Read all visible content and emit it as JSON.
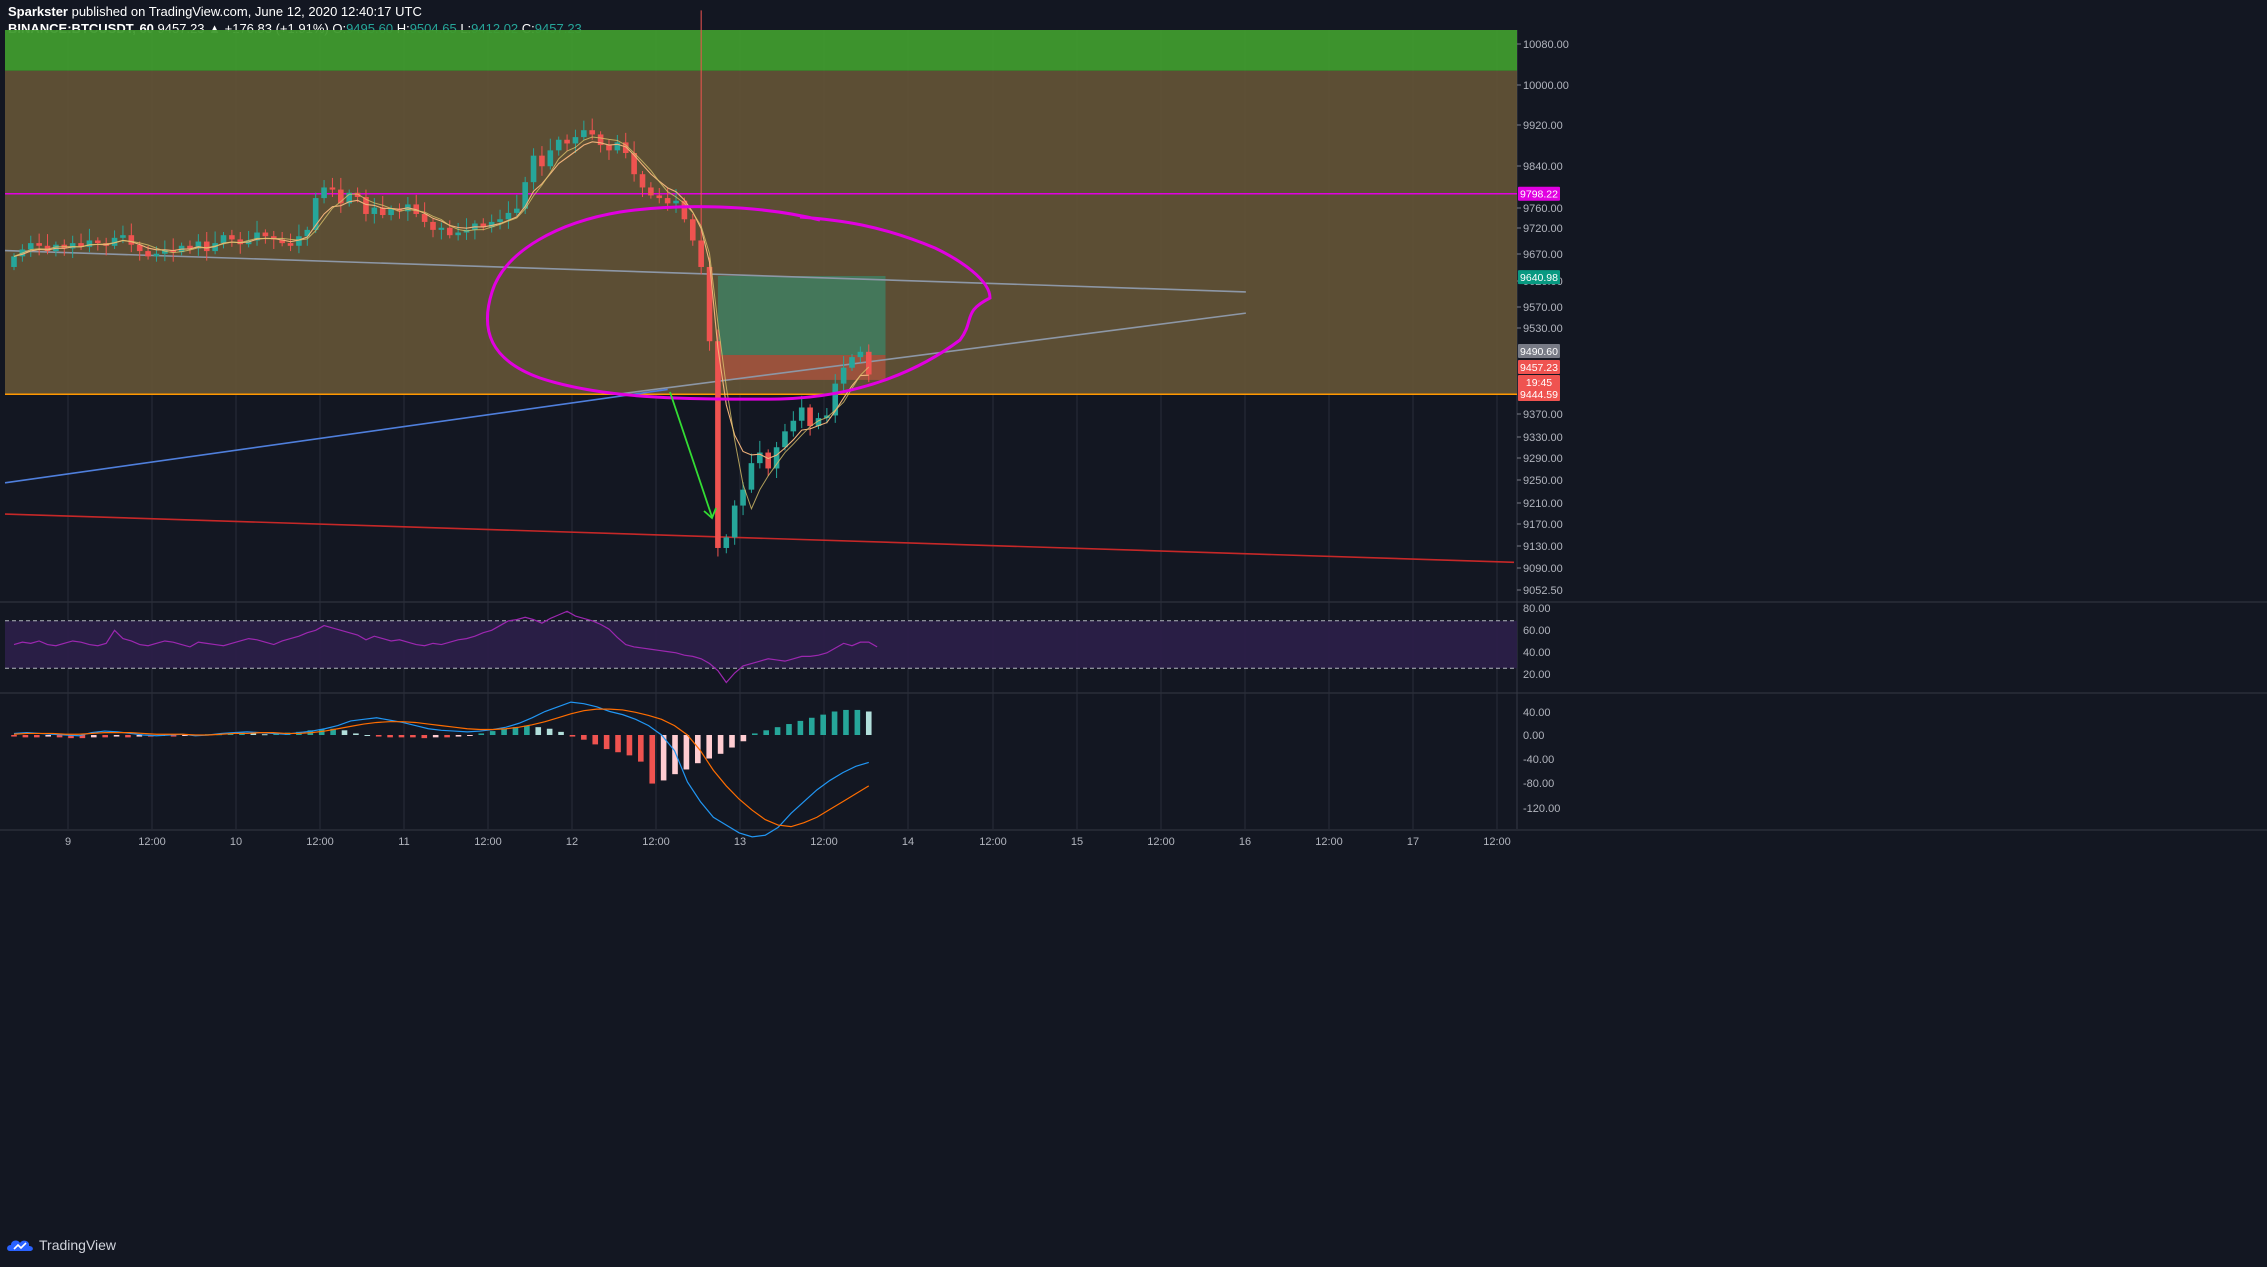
{
  "header": {
    "line1_prefix": "Sparkster",
    "line1_rest": " published on TradingView.com, June 12, 2020 12:40:17 UTC",
    "symbol": "BINANCE:BTCUSDT, 60",
    "last": "9457.23",
    "change": "▲ +176.83 (+1.91%)",
    "o_label": "O:",
    "o": "9495.60",
    "h_label": "H:",
    "h": "9504.65",
    "l_label": "L:",
    "l": "9412.02",
    "c_label": "C:",
    "c": "9457.23"
  },
  "footer": {
    "brand": "TradingView",
    "brand_icon": "tradingview-cloud-icon"
  },
  "colors": {
    "background": "#131722",
    "bull": "#26a69a",
    "bear": "#ef5350",
    "green_zone": "#3f9a2e",
    "olive_zone": "#635436",
    "magenta": "#e100e1",
    "orange_line": "#ff9800",
    "blue_trend": "#4f7fdc",
    "red_trend": "#c62828",
    "grey_trend": "#8d97a6",
    "rsi_line": "#9c27b0",
    "macd_line": "#2196f3",
    "signal_line": "#ff6d00"
  },
  "chart_data": [
    {
      "type": "candlestick",
      "title": "BINANCE:BTCUSDT, 60",
      "x_ticks": [
        "9",
        "12:00",
        "10",
        "12:00",
        "11",
        "12:00",
        "12",
        "12:00",
        "13",
        "12:00",
        "14",
        "12:00",
        "15",
        "12:00",
        "16",
        "12:00",
        "17",
        "12:00"
      ],
      "y_ticks": [
        "10080.00",
        "10000.00",
        "9920.00",
        "9840.00",
        "9760.00",
        "9720.00",
        "9670.00",
        "9620.00",
        "9570.00",
        "9530.00",
        "9370.00",
        "9330.00",
        "9290.00",
        "9250.00",
        "9210.00",
        "9170.00",
        "9130.00",
        "9090.00",
        "9052.50"
      ],
      "price_labels": [
        {
          "text": "9798.22",
          "value": 9798.22,
          "color": "#e100e1"
        },
        {
          "text": "9640.98",
          "value": 9640.98,
          "color": "#089981"
        },
        {
          "text": "9490.60",
          "value": 9490.6,
          "color": "#787b86"
        },
        {
          "text": "9457.23",
          "value": 9457.23,
          "color": "#ef5350"
        },
        {
          "text": "19:45",
          "value": 9436,
          "color": "#ef5350"
        },
        {
          "text": "9444.59",
          "value": 9414,
          "color": "#ef5350"
        }
      ],
      "zones": [
        {
          "name": "green-zone",
          "from": 10030,
          "to": 10107,
          "color": "#3f9a2e"
        },
        {
          "name": "olive-zone",
          "from": 9420,
          "to": 10030,
          "color": "#635436"
        }
      ],
      "horizontal_lines": [
        {
          "name": "magenta-level",
          "value": 9798.22,
          "color": "#e100e1"
        },
        {
          "name": "orange-level",
          "value": 9420,
          "color": "#ff9800"
        }
      ],
      "trend_lines": [
        {
          "name": "grey-upper-trend",
          "from": [
            0,
            9691
          ],
          "to": [
            147,
            9613
          ],
          "color": "#8d97a6"
        },
        {
          "name": "grey-lower-trend",
          "from": [
            72,
            9420
          ],
          "to": [
            147,
            9573
          ],
          "color": "#8d97a6"
        },
        {
          "name": "blue-support-trend",
          "from": [
            0,
            9253
          ],
          "to": [
            78,
            9429
          ],
          "color": "#4f7fdc"
        },
        {
          "name": "red-trend",
          "from": [
            0,
            9194
          ],
          "to": [
            179,
            9103
          ],
          "color": "#c62828"
        }
      ],
      "position_box": {
        "x_from": 84,
        "x_to": 104,
        "target": 9643,
        "entry": 9494,
        "stop": 9447
      },
      "annotations": [
        "magenta freehand ellipse around 9420-9760",
        "green arrow pointing down from 9420 to 9200"
      ],
      "candles": {
        "start": 9660,
        "end": 9457.23,
        "hourly_closes": [
          9680,
          9693,
          9705,
          9700,
          9690,
          9702,
          9695,
          9705,
          9698,
          9710,
          9705,
          9700,
          9715,
          9720,
          9702,
          9690,
          9680,
          9685,
          9692,
          9688,
          9700,
          9695,
          9708,
          9690,
          9705,
          9720,
          9712,
          9703,
          9710,
          9725,
          9718,
          9712,
          9705,
          9700,
          9718,
          9730,
          9790,
          9810,
          9806,
          9780,
          9800,
          9792,
          9760,
          9772,
          9758,
          9770,
          9765,
          9778,
          9760,
          9745,
          9730,
          9734,
          9720,
          9725,
          9730,
          9742,
          9735,
          9745,
          9750,
          9762,
          9770,
          9820,
          9870,
          9850,
          9880,
          9900,
          9893,
          9905,
          9918,
          9910,
          9890,
          9880,
          9895,
          9875,
          9835,
          9810,
          9795,
          9790,
          9780,
          9785,
          9750,
          9710,
          9660,
          9520,
          9130,
          9150,
          9210,
          9240,
          9290,
          9310,
          9280,
          9320,
          9350,
          9370,
          9395,
          9360,
          9375,
          9380,
          9440,
          9470,
          9490,
          9500,
          9457.23
        ]
      }
    },
    {
      "type": "line",
      "title": "RSI",
      "y_ticks": [
        "80.00",
        "60.00",
        "40.00",
        "20.00"
      ],
      "bands": [
        70,
        30
      ],
      "values": [
        50,
        52,
        51,
        53,
        50,
        49,
        51,
        53,
        52,
        50,
        49,
        51,
        62,
        55,
        53,
        50,
        49,
        51,
        53,
        52,
        50,
        48,
        52,
        51,
        50,
        49,
        51,
        53,
        55,
        54,
        52,
        50,
        53,
        55,
        57,
        60,
        62,
        66,
        64,
        62,
        60,
        58,
        54,
        57,
        55,
        53,
        54,
        52,
        50,
        49,
        51,
        50,
        52,
        54,
        55,
        57,
        60,
        62,
        66,
        70,
        71,
        73,
        71,
        68,
        72,
        75,
        78,
        74,
        72,
        70,
        67,
        63,
        56,
        50,
        48,
        47,
        46,
        45,
        44,
        43,
        41,
        40,
        38,
        34,
        28,
        18,
        26,
        32,
        34,
        36,
        38,
        37,
        36,
        38,
        40,
        40,
        41,
        43,
        47,
        51,
        49,
        52,
        52,
        48
      ]
    },
    {
      "type": "bar",
      "title": "MACD",
      "y_ticks": [
        "40.00",
        "0.00",
        "-40.00",
        "-80.00",
        "-120.00"
      ],
      "macd": [
        2,
        3,
        2,
        1,
        0,
        -1,
        3,
        5,
        4,
        2,
        0,
        -1,
        0,
        1,
        -1,
        0,
        2,
        3,
        4,
        3,
        2,
        1,
        3,
        5,
        8,
        12,
        18,
        20,
        22,
        19,
        16,
        12,
        8,
        6,
        5,
        4,
        5,
        7,
        10,
        15,
        22,
        30,
        36,
        42,
        40,
        36,
        30,
        26,
        20,
        12,
        0,
        -20,
        -60,
        -85,
        -105,
        -115,
        -125,
        -130,
        -128,
        -118,
        -100,
        -85,
        -70,
        -58,
        -48,
        -40,
        -35
      ],
      "signal": [
        1,
        2,
        2,
        2,
        1,
        1,
        2,
        3,
        3,
        3,
        2,
        1,
        1,
        1,
        0,
        0,
        1,
        2,
        2,
        3,
        3,
        2,
        2,
        3,
        5,
        8,
        11,
        14,
        16,
        17,
        17,
        16,
        14,
        12,
        10,
        8,
        7,
        7,
        8,
        10,
        13,
        17,
        22,
        27,
        31,
        33,
        33,
        32,
        29,
        25,
        20,
        12,
        0,
        -20,
        -45,
        -65,
        -82,
        -96,
        -108,
        -115,
        -117,
        -112,
        -105,
        -95,
        -85,
        -75,
        -65
      ],
      "histogram": [
        -2,
        -3,
        -3,
        -2,
        -3,
        -4,
        -4,
        -3,
        -3,
        -2,
        -3,
        -2,
        -2,
        -1,
        -2,
        -1,
        -1,
        1,
        1,
        2,
        3,
        2,
        1,
        2,
        3,
        4,
        6,
        7,
        8,
        6,
        2,
        0,
        -2,
        -3,
        -3,
        -3,
        -4,
        -3,
        -3,
        -2,
        -1,
        2,
        5,
        8,
        10,
        12,
        10,
        8,
        4,
        -2,
        -6,
        -12,
        -18,
        -22,
        -26,
        -34,
        -62,
        -58,
        -50,
        -44,
        -36,
        -30,
        -24,
        -16,
        -8,
        2,
        6,
        10,
        14,
        18,
        22,
        26,
        30,
        32,
        32,
        30
      ]
    }
  ]
}
